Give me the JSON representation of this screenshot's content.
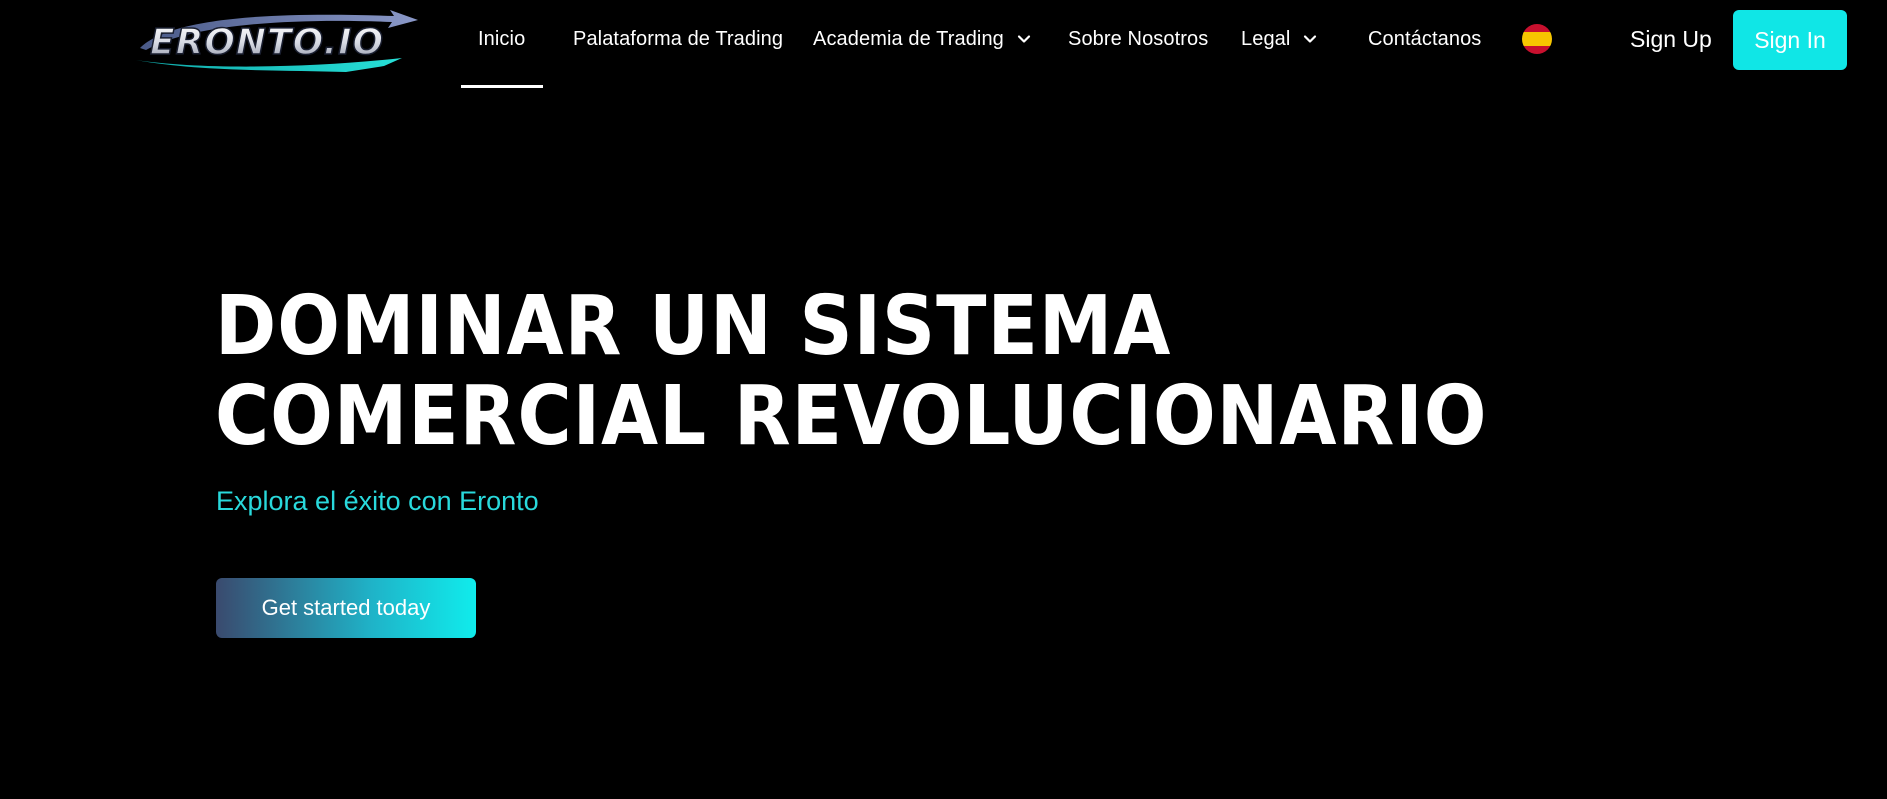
{
  "brand": {
    "logo_text": "ERONTO.IO",
    "accent_color": "#10e6e6",
    "subtitle_color": "#29d9dc"
  },
  "nav": {
    "items": [
      {
        "label": "Inicio",
        "active": true,
        "has_dropdown": false
      },
      {
        "label": "Palataforma de Trading",
        "active": false,
        "has_dropdown": false
      },
      {
        "label": "Academia de Trading",
        "active": false,
        "has_dropdown": true
      },
      {
        "label": "Sobre Nosotros",
        "active": false,
        "has_dropdown": false
      },
      {
        "label": "Legal",
        "active": false,
        "has_dropdown": true
      },
      {
        "label": "Contáctanos",
        "active": false,
        "has_dropdown": false
      }
    ],
    "language_icon": "spain-flag-icon",
    "sign_up": "Sign Up",
    "sign_in": "Sign In"
  },
  "hero": {
    "title_line1": "DOMINAR UN SISTEMA",
    "title_line2": "COMERCIAL REVOLUCIONARIO",
    "subtitle": "Explora el éxito con Eronto",
    "cta": "Get started today"
  }
}
